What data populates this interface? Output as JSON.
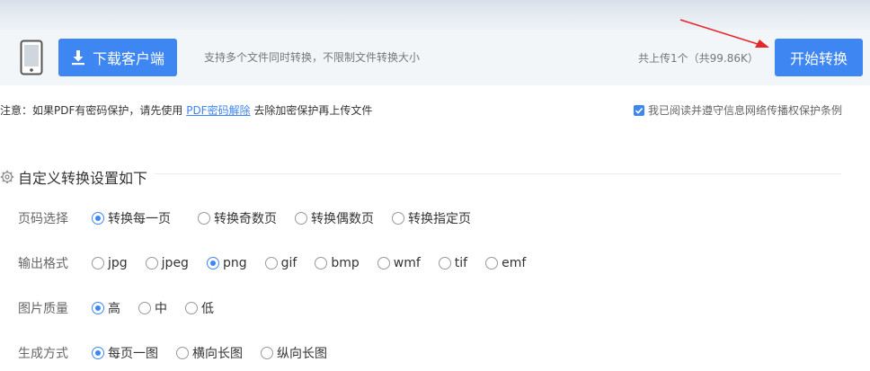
{
  "header": {
    "download_label": "下载客户端",
    "upload_hint": "支持多个文件同时转换，不限制文件转换大小",
    "upload_summary": "共上传1个（共99.86K）",
    "start_label": "开始转换"
  },
  "notice": {
    "prefix": "注意：如果PDF有密码保护，请先使用 ",
    "link": "PDF密码解除",
    "suffix": " 去除加密保护再上传文件"
  },
  "agree": {
    "label": "我已阅读并遵守信息网络传播权保护条例",
    "checked": true
  },
  "settings": {
    "title": "自定义转换设置如下",
    "rows": [
      {
        "label": "页码选择",
        "options": [
          "转换每一页",
          "转换奇数页",
          "转换偶数页",
          "转换指定页"
        ],
        "selected": 0
      },
      {
        "label": "输出格式",
        "options": [
          "jpg",
          "jpeg",
          "png",
          "gif",
          "bmp",
          "wmf",
          "tif",
          "emf"
        ],
        "selected": 2
      },
      {
        "label": "图片质量",
        "options": [
          "高",
          "中",
          "低"
        ],
        "selected": 0
      },
      {
        "label": "生成方式",
        "options": [
          "每页一图",
          "横向长图",
          "纵向长图"
        ],
        "selected": 0
      }
    ]
  },
  "colors": {
    "accent": "#3e86f2",
    "annotation_arrow": "#e8262a"
  }
}
